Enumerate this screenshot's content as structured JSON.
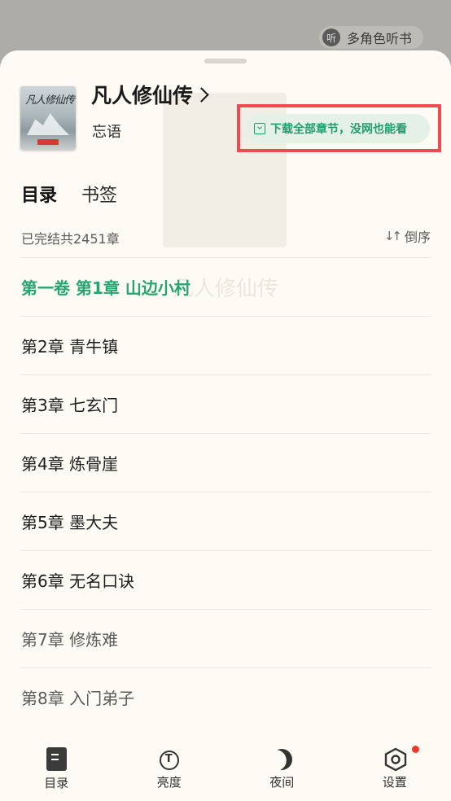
{
  "background": {
    "listen_badge": {
      "icon_char": "听",
      "label": "多角色听书"
    },
    "ghost_title": "凡人修仙传"
  },
  "book": {
    "title": "凡人修仙传",
    "author": "忘语",
    "cover_text": "凡人修仙传"
  },
  "download_button": {
    "label": "下载全部章节，没网也能看",
    "icon": "download-icon"
  },
  "tabs": [
    {
      "label": "目录",
      "active": true
    },
    {
      "label": "书签",
      "active": false
    }
  ],
  "summary": "已完结共2451章",
  "sort": {
    "icon_text": "↓↑",
    "label": "倒序"
  },
  "chapters": [
    {
      "title": "第一卷 第1章 山边小村",
      "current": true
    },
    {
      "title": "第2章 青牛镇",
      "current": false
    },
    {
      "title": "第3章 七玄门",
      "current": false
    },
    {
      "title": "第4章 炼骨崖",
      "current": false
    },
    {
      "title": "第5章 墨大夫",
      "current": false
    },
    {
      "title": "第6章 无名口诀",
      "current": false
    },
    {
      "title": "第7章 修炼难",
      "current": false
    },
    {
      "title": "第8章 入门弟子",
      "current": false
    }
  ],
  "bottom_nav": [
    {
      "label": "目录",
      "icon": "toc-icon"
    },
    {
      "label": "亮度",
      "icon": "brightness-icon"
    },
    {
      "label": "夜间",
      "icon": "night-mode-icon"
    },
    {
      "label": "设置",
      "icon": "settings-icon",
      "badge": true
    }
  ],
  "colors": {
    "accent": "#26a66f",
    "highlight_frame": "#ef4a4f",
    "badge": "#ea3b2e",
    "sheet_bg": "#fdfbf4"
  }
}
